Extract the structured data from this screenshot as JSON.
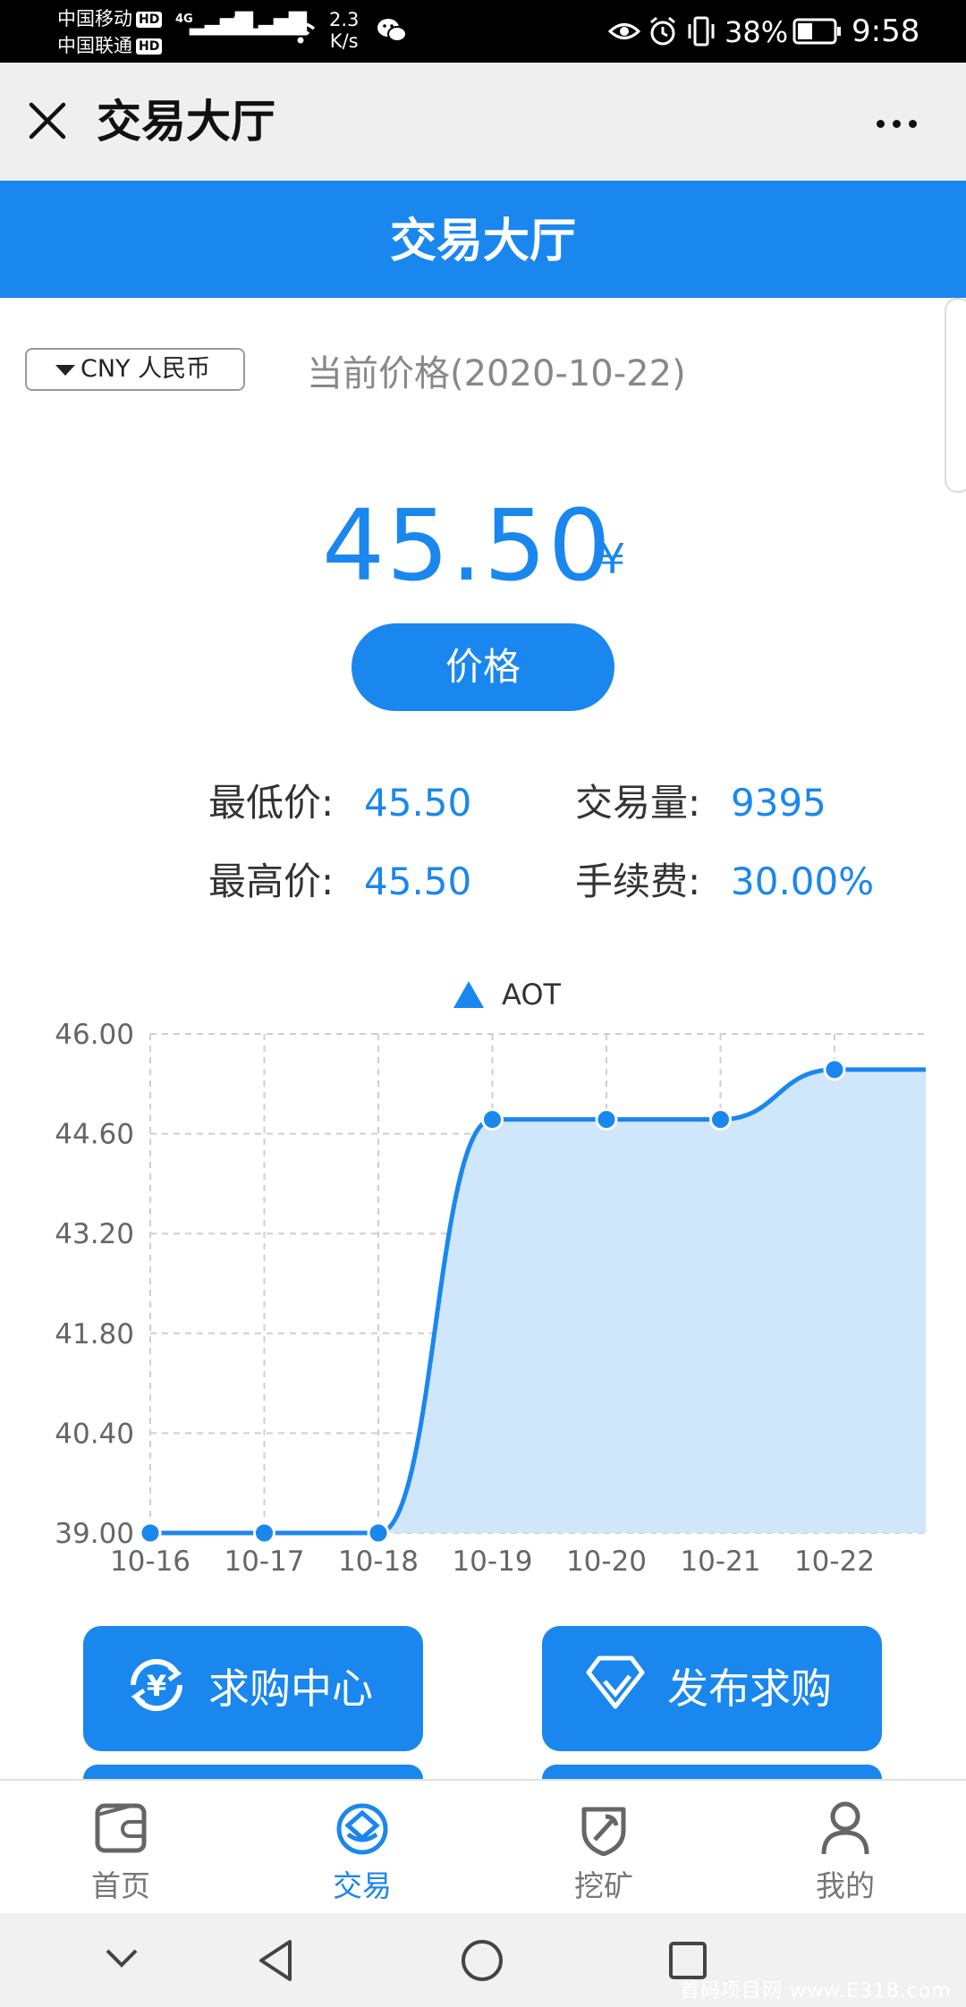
{
  "status_bar": {
    "carrier1": "中国移动",
    "carrier2": "中国联通",
    "hd": "HD",
    "net1": "4G",
    "net2": "4G",
    "speed": "2.3\nK/s",
    "battery": "38%",
    "time": "9:58"
  },
  "title_bar": {
    "title": "交易大厅"
  },
  "banner": {
    "title": "交易大厅"
  },
  "currency": {
    "selected": "CNY 人民币"
  },
  "price": {
    "label": "当前价格(2020-10-22)",
    "value": "45.50",
    "unit": "¥",
    "button": "价格"
  },
  "stats": {
    "low_label": "最低价:",
    "low_value": "45.50",
    "high_label": "最高价:",
    "high_value": "45.50",
    "volume_label": "交易量:",
    "volume_value": "9395",
    "fee_label": "手续费:",
    "fee_value": "30.00%"
  },
  "chart_data": {
    "type": "area",
    "legend": [
      "AOT"
    ],
    "x": [
      "10-16",
      "10-17",
      "10-18",
      "10-19",
      "10-20",
      "10-21",
      "10-22"
    ],
    "series": [
      {
        "name": "AOT",
        "values": [
          39.0,
          39.0,
          39.0,
          44.8,
          44.8,
          44.8,
          45.5
        ]
      }
    ],
    "yticks": [
      "46.00",
      "44.60",
      "43.20",
      "41.80",
      "40.40",
      "39.00"
    ],
    "ylim": [
      39.0,
      46.0
    ],
    "grid": true,
    "legend_position": "top-center",
    "color": "#1a87ee"
  },
  "actions": {
    "buy_center": "求购中心",
    "publish_buy": "发布求购"
  },
  "bottom_nav": {
    "home": "首页",
    "trade": "交易",
    "mining": "挖矿",
    "mine": "我的"
  },
  "colors": {
    "accent": "#1a87ee"
  },
  "watermark": "首码项目网 www.E318.com"
}
